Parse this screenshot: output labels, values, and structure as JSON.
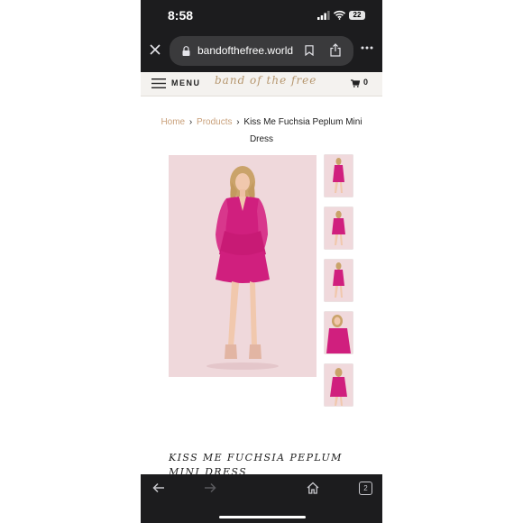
{
  "status_bar": {
    "time": "8:58",
    "battery": "22",
    "icons": [
      "signal-icon",
      "wifi-icon",
      "battery-icon"
    ]
  },
  "browser": {
    "url": "bandofthefree.world",
    "tab_count": "2",
    "icons": [
      "close-icon",
      "lock-icon",
      "bookmark-icon",
      "share-icon",
      "more-icon",
      "back-icon",
      "forward-icon",
      "home-icon"
    ]
  },
  "site_header": {
    "menu_label": "MENU",
    "brand": "band of the free",
    "cart_count": "0"
  },
  "breadcrumb": {
    "home": "Home",
    "sep": "›",
    "products": "Products",
    "current": "Kiss Me Fuchsia Peplum Mini Dress"
  },
  "product": {
    "title": "KISS ME FUCHSIA PEPLUM MINI DRESS",
    "colors": {
      "dress": "#d01f7e",
      "backdrop": "#efd8db",
      "accent": "#c9a07a"
    }
  }
}
